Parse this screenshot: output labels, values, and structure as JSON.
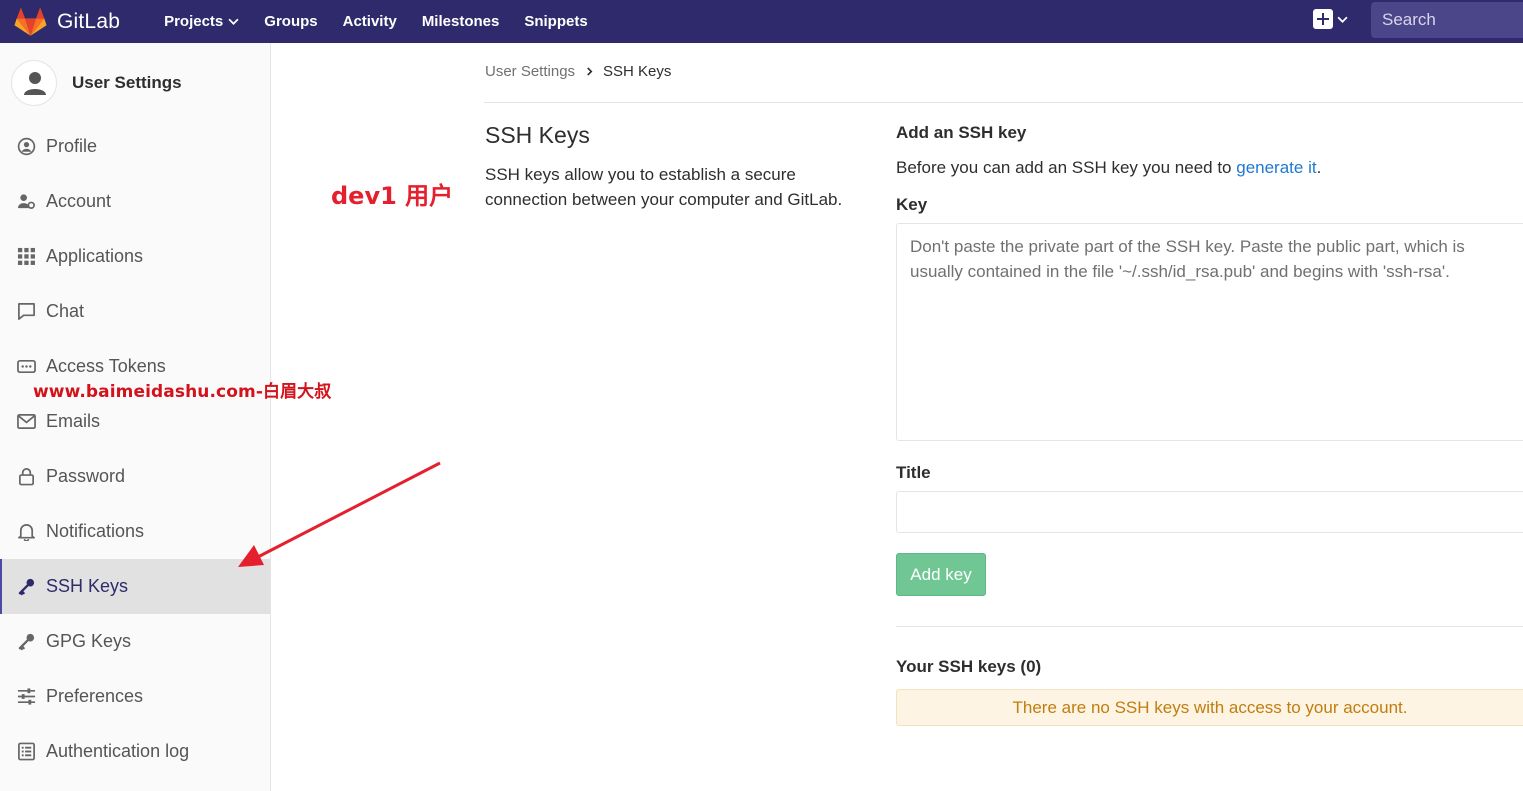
{
  "brand": {
    "name": "GitLab",
    "logo_icon": "gitlab-tanuki-icon"
  },
  "topnav": {
    "links": [
      {
        "label": "Projects",
        "dropdown": true
      },
      {
        "label": "Groups"
      },
      {
        "label": "Activity"
      },
      {
        "label": "Milestones"
      },
      {
        "label": "Snippets"
      }
    ],
    "new_menu_icon": "plus-square-icon",
    "search_placeholder": "Search"
  },
  "sidebar": {
    "title": "User Settings",
    "items": [
      {
        "label": "Profile",
        "icon": "profile-icon"
      },
      {
        "label": "Account",
        "icon": "account-icon"
      },
      {
        "label": "Applications",
        "icon": "applications-icon"
      },
      {
        "label": "Chat",
        "icon": "chat-icon"
      },
      {
        "label": "Access Tokens",
        "icon": "access-tokens-icon"
      },
      {
        "label": "Emails",
        "icon": "email-icon"
      },
      {
        "label": "Password",
        "icon": "lock-icon"
      },
      {
        "label": "Notifications",
        "icon": "bell-icon"
      },
      {
        "label": "SSH Keys",
        "icon": "key-icon",
        "active": true
      },
      {
        "label": "GPG Keys",
        "icon": "key-icon"
      },
      {
        "label": "Preferences",
        "icon": "sliders-icon"
      },
      {
        "label": "Authentication log",
        "icon": "log-icon"
      }
    ]
  },
  "breadcrumb": {
    "parent": "User Settings",
    "current": "SSH Keys"
  },
  "intro": {
    "heading": "SSH Keys",
    "description": "SSH keys allow you to establish a secure connection between your computer and GitLab."
  },
  "add_key": {
    "heading": "Add an SSH key",
    "text_before": "Before you can add an SSH key you need to ",
    "link_text": "generate it",
    "text_after": ".",
    "key_label": "Key",
    "key_placeholder": "Don't paste the private part of the SSH key. Paste the public part, which is usually contained in the file '~/.ssh/id_rsa.pub' and begins with 'ssh-rsa'.",
    "title_label": "Title",
    "title_value": "",
    "button_label": "Add key"
  },
  "your_keys": {
    "heading": "Your SSH keys (0)",
    "empty_message": "There are no SSH keys with access to your account."
  },
  "annotations": {
    "user_label": "dev1 用户",
    "watermark": "www.baimeidashu.com-白眉大叔",
    "arrow_color": "#e5202e"
  },
  "colors": {
    "nav_bg": "#2f2a6b",
    "link": "#1f78d1",
    "button_green": "#71c794",
    "warning_bg": "#fdf4e3"
  }
}
